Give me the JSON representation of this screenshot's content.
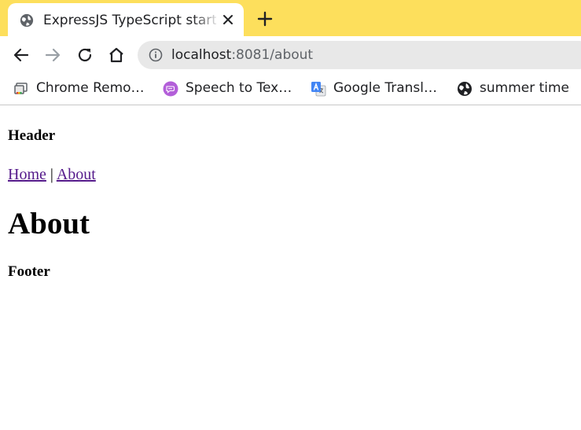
{
  "browser": {
    "tab": {
      "title": "ExpressJS TypeScript starter",
      "favicon": "globe-icon"
    },
    "toolbar": {
      "url_host": "localhost",
      "url_path": ":8081/about"
    },
    "bookmarks": [
      {
        "label": "Chrome Remo…",
        "icon": "chrome-remote-icon"
      },
      {
        "label": "Speech to Tex…",
        "icon": "speech-icon"
      },
      {
        "label": "Google Transl…",
        "icon": "google-translate-icon"
      },
      {
        "label": "summer time",
        "icon": "globe-icon"
      }
    ],
    "colors": {
      "tabstrip": "#fddf5c",
      "omnibox": "#e8e8e8",
      "visited_link": "#551a8b"
    }
  },
  "page": {
    "header": "Header",
    "nav": {
      "home": "Home",
      "separator": "|",
      "about": "About"
    },
    "title": "About",
    "footer": "Footer"
  }
}
